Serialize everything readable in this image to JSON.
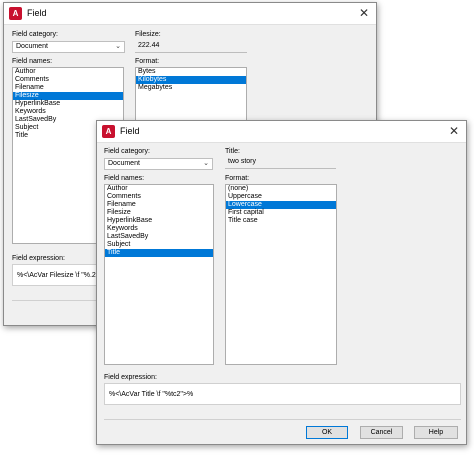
{
  "back_dialog": {
    "title": "Field",
    "field_category_label": "Field category:",
    "field_category_value": "Document",
    "field_names_label": "Field names:",
    "field_names": [
      "Author",
      "Comments",
      "Filename",
      "Filesize",
      "HyperlinkBase",
      "Keywords",
      "LastSavedBy",
      "Subject",
      "Title"
    ],
    "field_names_selected_index": 3,
    "value_label": "Filesize:",
    "value": "222.44",
    "format_label": "Format:",
    "formats": [
      "Bytes",
      "Kilobytes",
      "Megabytes"
    ],
    "format_selected_index": 1,
    "expression_label": "Field expression:",
    "expression": "%<\\AcVar Filesize \\f \"%.2"
  },
  "front_dialog": {
    "title": "Field",
    "field_category_label": "Field category:",
    "field_category_value": "Document",
    "field_names_label": "Field names:",
    "field_names": [
      "Author",
      "Comments",
      "Filename",
      "Filesize",
      "HyperlinkBase",
      "Keywords",
      "LastSavedBy",
      "Subject",
      "Title"
    ],
    "field_names_selected_index": 8,
    "value_label": "Title:",
    "value": "two story",
    "format_label": "Format:",
    "formats": [
      "(none)",
      "Uppercase",
      "Lowercase",
      "First capital",
      "Title case"
    ],
    "format_selected_index": 2,
    "expression_label": "Field expression:",
    "expression": "%<\\AcVar Title \\f \"%tc2\">%",
    "buttons": {
      "ok": "OK",
      "cancel": "Cancel",
      "help": "Help"
    }
  },
  "icons": {
    "app": "autocad-icon",
    "close": "close-icon",
    "dropdown": "chevron-down-icon"
  },
  "colors": {
    "selection": "#0078d7",
    "app_icon": "#c8102e"
  }
}
